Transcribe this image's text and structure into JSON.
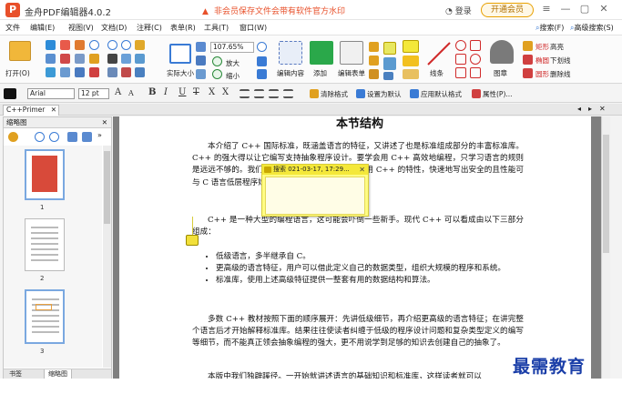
{
  "app": {
    "logo_letter": "P",
    "title": "金舟PDF编辑器4.0.2",
    "notice": "非会员保存文件会带有软件官方水印",
    "login": "登录",
    "vip": "开通会员",
    "win_min": "—",
    "win_max": "▢",
    "win_close": "✕"
  },
  "menu": {
    "items": [
      "文件",
      "编辑(E)",
      "视图(V)",
      "文档(D)",
      "注释(C)",
      "表单(R)",
      "工具(T)",
      "窗口(W)"
    ],
    "search": "搜索(F)",
    "adv_search": "高级搜索(S)"
  },
  "ribbon": {
    "open": "打开(O)",
    "actual_size": "实际大小",
    "zoom": "107.65%",
    "zoom_in": "放大",
    "zoom_out": "缩小",
    "edit_content": "编辑内容",
    "add": "添加",
    "edit_form": "编辑表单",
    "line": "线条",
    "figure": "图章",
    "rect": "矩形",
    "ellipse": "椭圆",
    "circle": "圆形",
    "highlight": "高亮",
    "underline": "下划线",
    "strike": "删除线"
  },
  "format": {
    "font": "Arial",
    "size": "12 pt",
    "btn_A_up": "A",
    "btn_A_down": "A",
    "bold": "B",
    "italic": "I",
    "underline": "U",
    "strike": "T",
    "sub": "X",
    "sup": "X",
    "clear": "清除格式",
    "set_default": "设置为默认",
    "apply_default": "应用默认格式",
    "props": "属性(P)..."
  },
  "tab": {
    "name": "C++Primer",
    "close": "✕"
  },
  "sidebar": {
    "title": "缩略图",
    "close": "✕",
    "thumbs": [
      "1",
      "2",
      "3"
    ],
    "tab_bookmarks": "书签",
    "tab_thumbs": "缩略图"
  },
  "doc": {
    "heading": "本节结构",
    "p1": "本介绍了 C++ 国际标准，既涵盖语言的特征，又讲述了也是标准组成部分的丰富标准库。C++ 的强大得以让它编写支持抽象程序设计。要学会用 C++ 高效地编程，只学习语言的规则是远远不够的。我们的重点在于，教会读者怎样利用 C++ 的特性，快速地写出安全的且性能可与 C 语言低层程序媲美的程序。",
    "p2": "C++ 是一种大型的编程语言，这可能会吓倒一些新手。现代 C++ 可以看成由以下三部分组成：",
    "bullets": [
      "低级语言，多半继承自 C。",
      "更高级的语言特征，用户可以借此定义自己的数据类型，组织大规模的程序和系统。",
      "标准库，使用上述高级特征提供一整套有用的数据结构和算法。"
    ],
    "p3": "多数 C++ 教材按照下面的顺序展开：先讲低级细节，再介绍更高级的语言特征；在讲完整个语言后才开始解释标准库。结果往往使读者纠缠于低级的程序设计问题和复杂类型定义的编写等细节，而不能真正领会抽象编程的强大，更不用说学到足够的知识去创建自己的抽象了。",
    "p4": "本版中我们独辟蹊径。一开始就讲述语言的基础知识和标准库，这样读者就可以"
  },
  "note": {
    "author_time": "搜索 021-03-17, 17:29...",
    "close": "✕"
  },
  "watermark": "最需教育"
}
